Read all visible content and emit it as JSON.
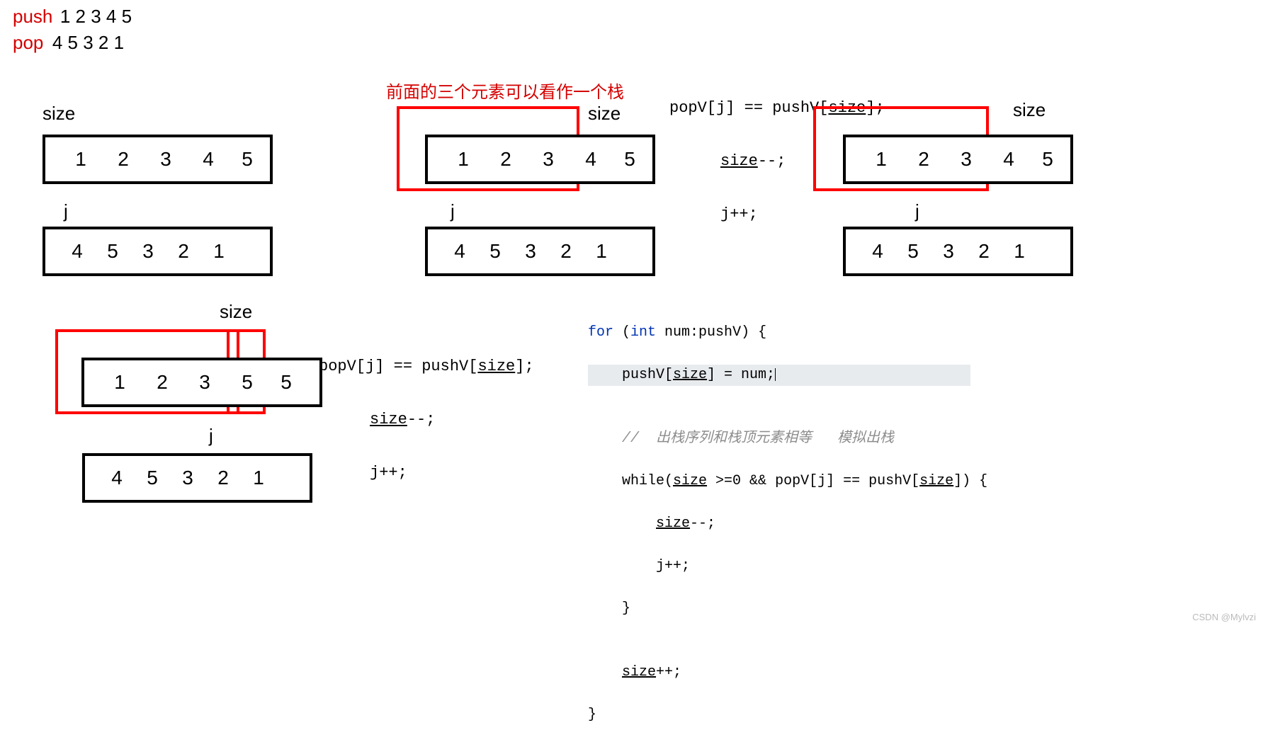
{
  "header": {
    "push_label": "push",
    "pop_label": "pop",
    "push_seq": "1  2   3   4    5",
    "pop_seq": "4   5  3  2   1"
  },
  "annotation": {
    "red_text": "前面的三个元素可以看作一个栈"
  },
  "labels": {
    "size": "size",
    "j": "j"
  },
  "arrays": {
    "push_12345": [
      "1",
      "2",
      "3",
      "4",
      "5"
    ],
    "push_12355": [
      "1",
      "2",
      "3",
      "5",
      "5"
    ],
    "pop_45321": [
      "4",
      "5",
      "3",
      "2",
      "1"
    ]
  },
  "snippet1": {
    "line1_a": "popV[j] == pushV[",
    "line1_b": "size",
    "line1_c": "];",
    "line2_a": "size",
    "line2_b": "--;",
    "line3": "j++;"
  },
  "codeblock": {
    "l1_a": "for ",
    "l1_b": "(",
    "l1_c": "int ",
    "l1_d": "num:pushV) {",
    "l2_a": "    pushV[",
    "l2_b": "size",
    "l2_c": "] = num;",
    "l3": "",
    "l4": "    //  出栈序列和栈顶元素相等   模拟出栈",
    "l5_a": "    while(",
    "l5_b": "size",
    "l5_c": " >=0 && popV[j] == pushV[",
    "l5_d": "size",
    "l5_e": "]) {",
    "l6_a": "        ",
    "l6_b": "size",
    "l6_c": "--;",
    "l7": "        j++;",
    "l8": "    }",
    "l9": "",
    "l10_a": "    ",
    "l10_b": "size",
    "l10_c": "++;",
    "l11": "}"
  },
  "watermark": "CSDN @Mylvzi"
}
